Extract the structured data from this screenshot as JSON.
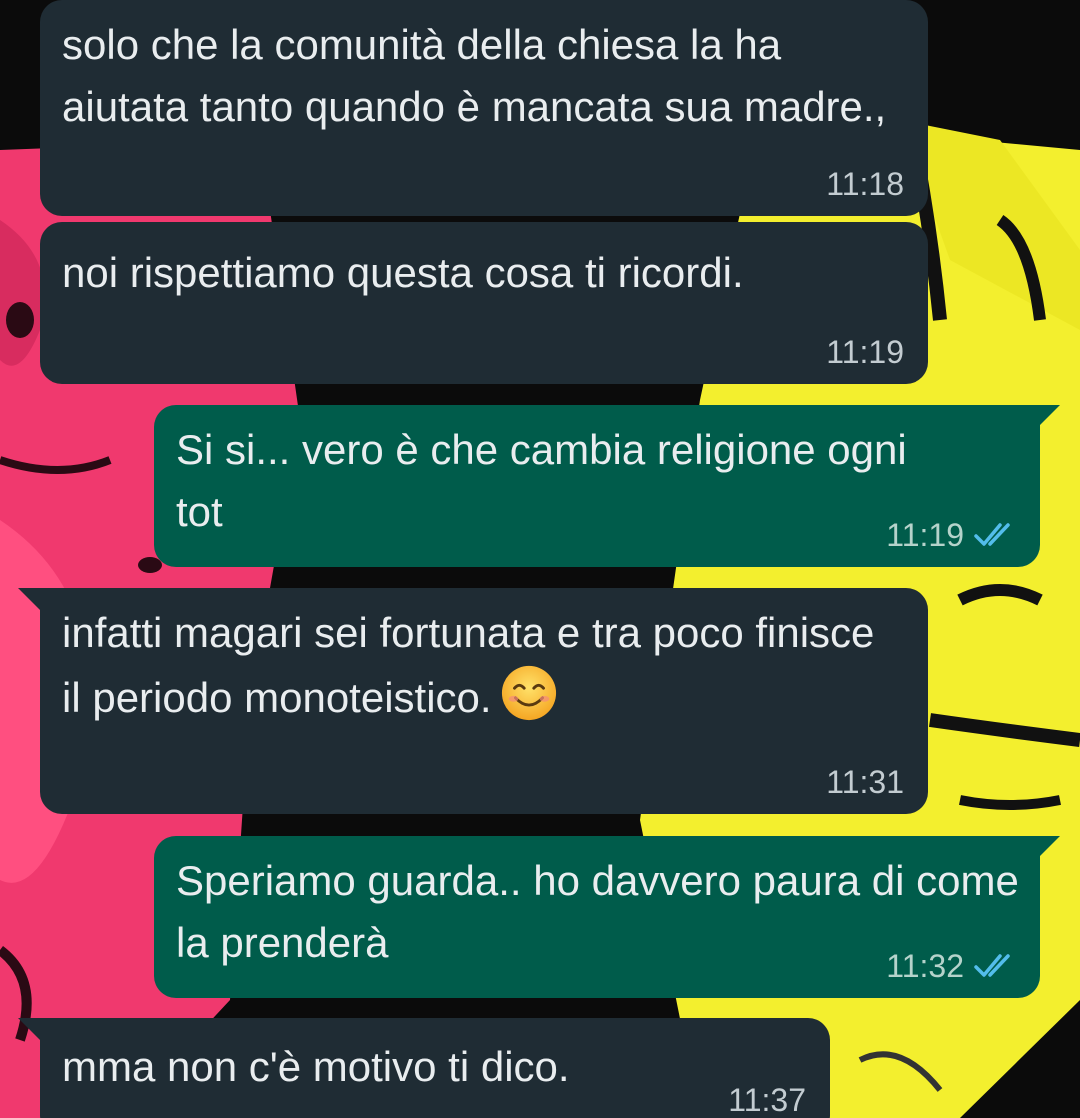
{
  "chat": {
    "messages": [
      {
        "direction": "incoming",
        "text": "solo che la comunità della chiesa la ha aiutata tanto quando è mancata sua madre.,",
        "time": "11:18"
      },
      {
        "direction": "incoming",
        "text": "noi rispettiamo questa cosa ti ricordi.",
        "time": "11:19"
      },
      {
        "direction": "outgoing",
        "text": "Si si... vero è che cambia religione ogni tot",
        "time": "11:19",
        "status": "read-double-check-icon"
      },
      {
        "direction": "incoming",
        "text": "infatti magari sei fortunata e tra poco finisce il periodo monoteistico.",
        "emoji": "smiling-face-emoji",
        "time": "11:31"
      },
      {
        "direction": "outgoing",
        "text": "Speriamo guarda.. ho davvero paura di come la prenderà",
        "time": "11:32",
        "status": "read-double-check-icon"
      },
      {
        "direction": "incoming",
        "text": "mma non c'è motivo ti dico.",
        "time": "11:37"
      }
    ]
  },
  "colors": {
    "incoming_bubble": "#1f2c34",
    "outgoing_bubble": "#005c4b",
    "text": "#e9edef",
    "read_ticks": "#53bdeb"
  }
}
